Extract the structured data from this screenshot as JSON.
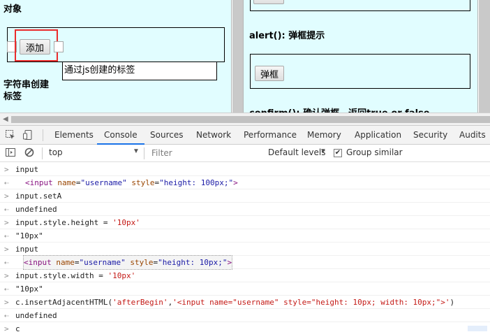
{
  "page": {
    "left": {
      "heading_top": "对象",
      "add_button": "添加",
      "label_text": "通过js创建的标签",
      "heading_string": "字符串创建\n标签"
    },
    "right": {
      "alert_heading": "alert(): 弹框提示",
      "alert_button": "弹框",
      "confirm_heading": "confirm(): 确认弹框，返回true or false"
    }
  },
  "devtools": {
    "tabs": [
      "Elements",
      "Console",
      "Sources",
      "Network",
      "Performance",
      "Memory",
      "Application",
      "Security",
      "Audits"
    ],
    "active_tab": "Console",
    "context": "top",
    "filter_placeholder": "Filter",
    "levels": "Default levels",
    "group_similar": "Group similar",
    "group_similar_checked": true
  },
  "console": {
    "l1_in": "input",
    "l2_out": {
      "tag": "<input",
      "attr1": "name",
      "val1": "\"username\"",
      "attr2": "style",
      "val2": "\"height: 100px;\"",
      "close": ">"
    },
    "l3_in": "input.setA",
    "l4_out": "undefined",
    "l5_in_pre": "input.style.height = ",
    "l5_in_str": "'10px'",
    "l6_out": "\"10px\"",
    "l7_in": "input",
    "l8_out": {
      "tag": "<input",
      "attr1": "name",
      "val1": "\"username\"",
      "attr2": "style",
      "val2": "\"height: 10px;\"",
      "close": ">"
    },
    "l9_in_pre": "input.style.width = ",
    "l9_in_str": "'10px'",
    "l10_out": "\"10px\"",
    "l11_in_pre": "c.insertAdjacentHTML(",
    "l11_in_str1": "'afterBegin'",
    "l11_in_comma": ",",
    "l11_in_str2": "'<input name=\"username\" style=\"height: 10px; width: 10px;\">'",
    "l11_in_post": ")",
    "l12_out": "undefined",
    "l13_in": "c"
  }
}
